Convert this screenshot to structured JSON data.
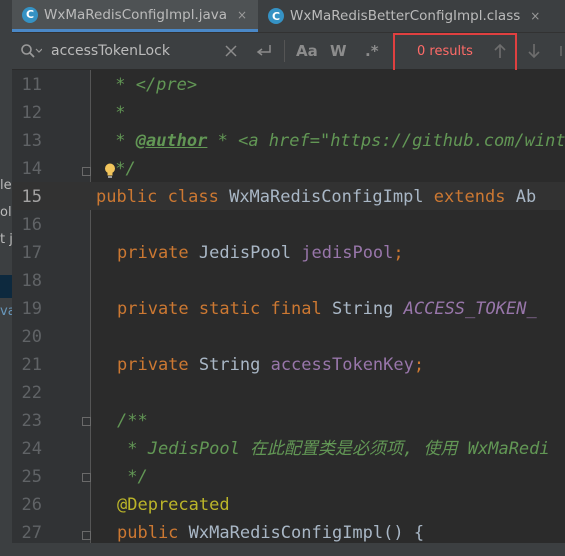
{
  "tabs": [
    {
      "icon_letter": "C",
      "label": "WxMaRedisConfigImpl.java",
      "close": "×",
      "active": true
    },
    {
      "icon_letter": "C",
      "label": "WxMaRedisBetterConfigImpl.class",
      "close": "×",
      "active": false
    }
  ],
  "left_panel_fragments": [
    "le",
    "oll",
    "t ja",
    "va"
  ],
  "find_bar": {
    "query": "accessTokenLock",
    "match_case": "Aa",
    "words": "W",
    "regex": ".*",
    "results": "0 results"
  },
  "editor": {
    "lines": [
      {
        "n": "11",
        "text": " * </pre>"
      },
      {
        "n": "12",
        "text": " *"
      },
      {
        "n": "13",
        "tag": "@author",
        "text": " * <a href=\"https://github.com/wint"
      },
      {
        "n": "14",
        "text": " */"
      },
      {
        "n": "15",
        "kw": "public class",
        "name": "WxMaRedisConfigImpl",
        "kw2": "extends",
        "rest": "Ab"
      },
      {
        "n": "16"
      },
      {
        "n": "17",
        "kw": "private",
        "type": "JedisPool",
        "field": "jedisPool"
      },
      {
        "n": "18"
      },
      {
        "n": "19",
        "kw": "private static final",
        "type": "String",
        "const": "ACCESS_TOKEN_"
      },
      {
        "n": "20"
      },
      {
        "n": "21",
        "kw": "private",
        "type": "String",
        "field": "accessTokenKey"
      },
      {
        "n": "22"
      },
      {
        "n": "23",
        "text": "/**"
      },
      {
        "n": "24",
        "text": " * JedisPool 在此配置类是必须项, 使用 WxMaRedi"
      },
      {
        "n": "25",
        "text": " */"
      },
      {
        "n": "26",
        "annotation": "@Deprecated"
      },
      {
        "n": "27",
        "kw": "public",
        "ctor": "WxMaRedisConfigImpl() {"
      }
    ]
  },
  "colors": {
    "keyword": "#cc7832",
    "comment": "#629755",
    "field": "#9876aa",
    "annotation": "#bbb529",
    "text": "#a9b7c6",
    "results_highlight": "#e04040"
  }
}
